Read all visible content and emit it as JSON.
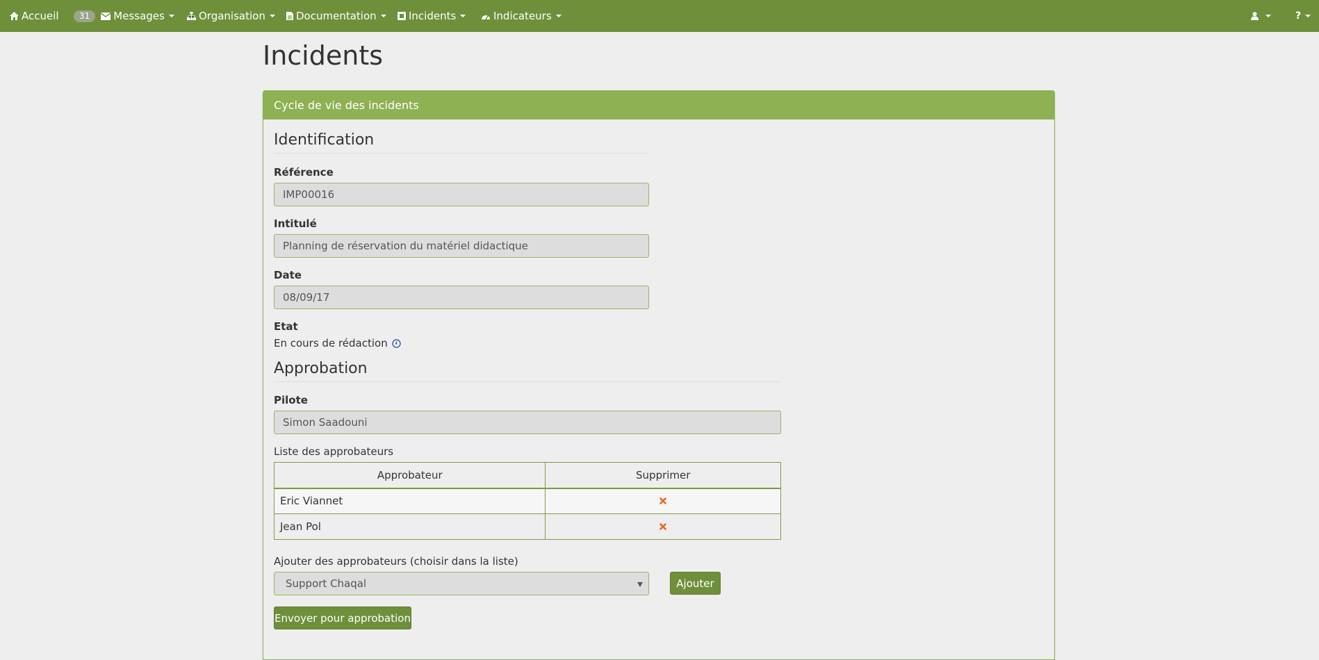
{
  "navbar": {
    "home_label": "Accueil",
    "messages_count": "31",
    "messages_label": "Messages",
    "organisation_label": "Organisation",
    "documentation_label": "Documentation",
    "incidents_label": "Incidents",
    "indicateurs_label": "Indicateurs",
    "help_label": "?"
  },
  "page": {
    "title": "Incidents"
  },
  "panel": {
    "heading": "Cycle de vie des incidents",
    "identification": {
      "legend": "Identification",
      "reference_label": "Référence",
      "reference_value": "IMP00016",
      "intitule_label": "Intitulé",
      "intitule_value": "Planning de réservation du matériel didactique",
      "date_label": "Date",
      "date_value": "08/09/17",
      "etat_label": "Etat",
      "etat_value": "En cours de rédaction"
    },
    "approbation": {
      "legend": "Approbation",
      "pilote_label": "Pilote",
      "pilote_value": "Simon Saadouni",
      "list_label": "Liste des approbateurs",
      "table": {
        "columns": [
          "Approbateur",
          "Supprimer"
        ],
        "rows": [
          {
            "name": "Eric Viannet"
          },
          {
            "name": "Jean Pol"
          }
        ]
      },
      "add_label": "Ajouter des approbateurs (choisir dans la liste)",
      "add_select_value": "Support Chaqal",
      "add_button": "Ajouter",
      "send_button": "Envoyer pour approbation"
    }
  },
  "colors": {
    "navbar": "#6f8f3b",
    "panel_heading": "#8eb153",
    "delete_icon": "#e36a1c",
    "info_icon": "#3b5bb5"
  },
  "icons": {
    "home": "home-icon",
    "messages": "envelope-icon",
    "organisation": "sitemap-icon",
    "documentation": "file-icon",
    "incidents": "incident-icon",
    "indicateurs": "dashboard-icon",
    "user": "user-icon",
    "etat_info": "clock-icon",
    "delete": "delete-icon"
  }
}
